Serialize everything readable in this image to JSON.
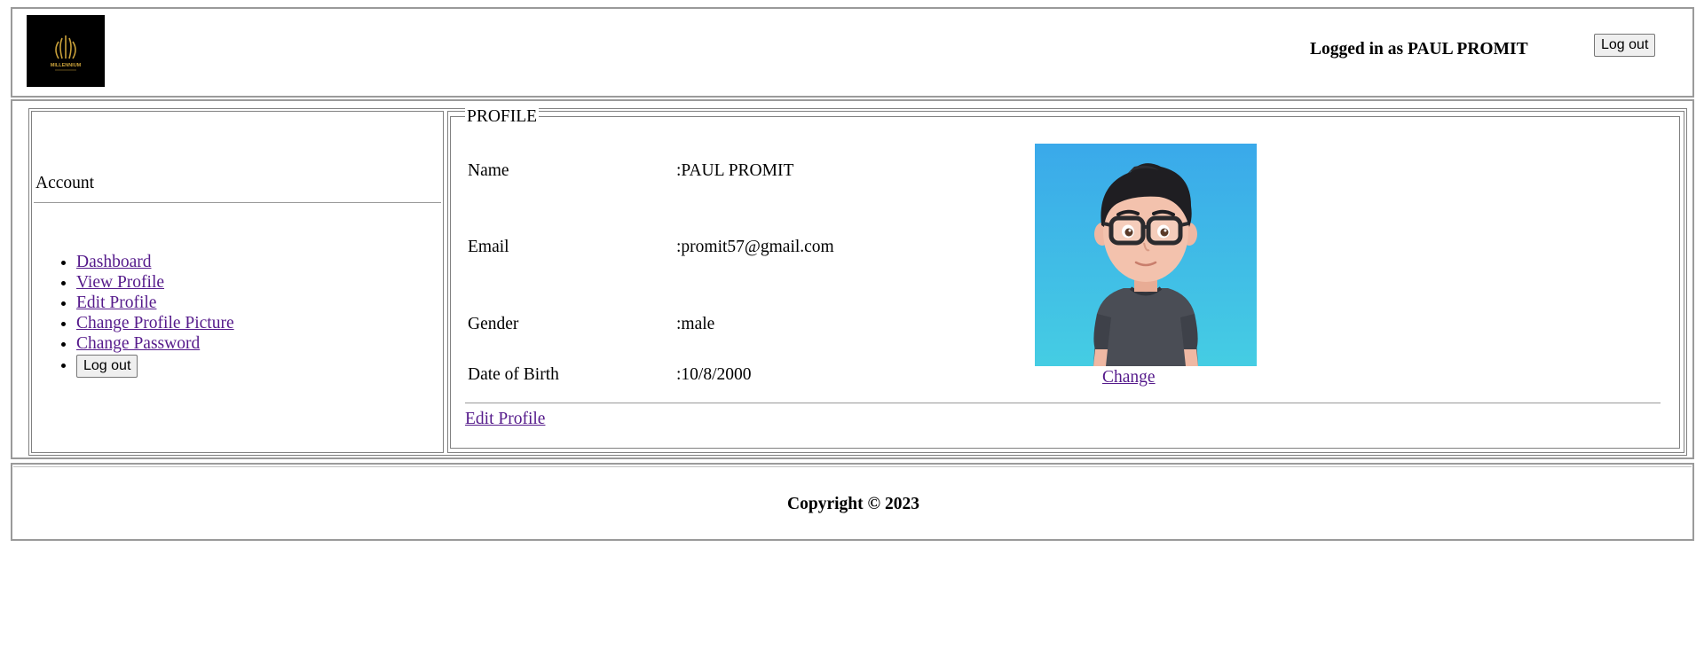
{
  "header": {
    "logo_text": "MILLENNIUM",
    "logged_in_text": "Logged in as PAUL PROMIT",
    "logout_label": "Log out"
  },
  "sidebar": {
    "title": "Account",
    "items": [
      {
        "label": "Dashboard"
      },
      {
        "label": "View Profile"
      },
      {
        "label": "Edit Profile"
      },
      {
        "label": "Change Profile Picture"
      },
      {
        "label": "Change Password"
      }
    ],
    "logout_label": "Log out"
  },
  "profile": {
    "legend": "PROFILE",
    "fields": [
      {
        "label": "Name",
        "value": ":PAUL PROMIT"
      },
      {
        "label": "Email",
        "value": ":promit57@gmail.com"
      },
      {
        "label": "Gender",
        "value": ":male"
      },
      {
        "label": "Date of Birth",
        "value": ":10/8/2000"
      }
    ],
    "change_label": "Change",
    "edit_label": "Edit Profile"
  },
  "footer": {
    "copyright": "Copyright © 2023"
  },
  "colors": {
    "link": "#551a8b",
    "border": "#9a9a9a",
    "logo_gold": "#c9a13a",
    "avatar_bg_top": "#3aa9ea",
    "avatar_bg_bottom": "#45cde3"
  }
}
